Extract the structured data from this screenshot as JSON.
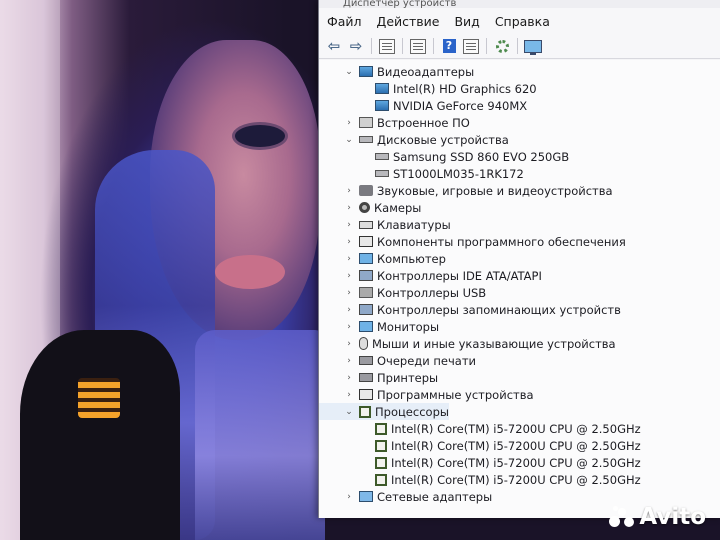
{
  "window": {
    "title": "Диспетчер устройств",
    "menu": [
      "Файл",
      "Действие",
      "Вид",
      "Справка"
    ]
  },
  "toolbar_icons": [
    "back-arrow-icon",
    "forward-arrow-icon",
    "properties-icon",
    "update-icon",
    "help-icon",
    "details-icon",
    "scan-icon",
    "monitor-icon"
  ],
  "tree": [
    {
      "label": "Видеоадаптеры",
      "level": 0,
      "expanded": true,
      "icon": "display-adapter-icon"
    },
    {
      "label": "Intel(R) HD Graphics 620",
      "level": 1,
      "icon": "display-adapter-icon"
    },
    {
      "label": "NVIDIA GeForce 940MX",
      "level": 1,
      "icon": "display-adapter-icon"
    },
    {
      "label": "Встроенное ПО",
      "level": 0,
      "expanded": false,
      "icon": "firmware-icon"
    },
    {
      "label": "Дисковые устройства",
      "level": 0,
      "expanded": true,
      "icon": "disk-icon"
    },
    {
      "label": "Samsung SSD 860 EVO 250GB",
      "level": 1,
      "icon": "disk-icon"
    },
    {
      "label": "ST1000LM035-1RK172",
      "level": 1,
      "icon": "disk-icon"
    },
    {
      "label": "Звуковые, игровые и видеоустройства",
      "level": 0,
      "expanded": false,
      "icon": "sound-icon"
    },
    {
      "label": "Камеры",
      "level": 0,
      "expanded": false,
      "icon": "camera-icon"
    },
    {
      "label": "Клавиатуры",
      "level": 0,
      "expanded": false,
      "icon": "keyboard-icon"
    },
    {
      "label": "Компоненты программного обеспечения",
      "level": 0,
      "expanded": false,
      "icon": "software-icon"
    },
    {
      "label": "Компьютер",
      "level": 0,
      "expanded": false,
      "icon": "computer-icon"
    },
    {
      "label": "Контроллеры IDE ATA/ATAPI",
      "level": 0,
      "expanded": false,
      "icon": "controller-icon"
    },
    {
      "label": "Контроллеры USB",
      "level": 0,
      "expanded": false,
      "icon": "usb-icon"
    },
    {
      "label": "Контроллеры запоминающих устройств",
      "level": 0,
      "expanded": false,
      "icon": "storage-controller-icon"
    },
    {
      "label": "Мониторы",
      "level": 0,
      "expanded": false,
      "icon": "monitor-icon"
    },
    {
      "label": "Мыши и иные указывающие устройства",
      "level": 0,
      "expanded": false,
      "icon": "mouse-icon"
    },
    {
      "label": "Очереди печати",
      "level": 0,
      "expanded": false,
      "icon": "print-queue-icon"
    },
    {
      "label": "Принтеры",
      "level": 0,
      "expanded": false,
      "icon": "printer-icon"
    },
    {
      "label": "Программные устройства",
      "level": 0,
      "expanded": false,
      "icon": "software-device-icon"
    },
    {
      "label": "Процессоры",
      "level": 0,
      "expanded": true,
      "icon": "cpu-icon"
    },
    {
      "label": "Intel(R) Core(TM) i5-7200U CPU @ 2.50GHz",
      "level": 1,
      "icon": "cpu-icon"
    },
    {
      "label": "Intel(R) Core(TM) i5-7200U CPU @ 2.50GHz",
      "level": 1,
      "icon": "cpu-icon"
    },
    {
      "label": "Intel(R) Core(TM) i5-7200U CPU @ 2.50GHz",
      "level": 1,
      "icon": "cpu-icon"
    },
    {
      "label": "Intel(R) Core(TM) i5-7200U CPU @ 2.50GHz",
      "level": 1,
      "icon": "cpu-icon"
    },
    {
      "label": "Сетевые адаптеры",
      "level": 0,
      "expanded": false,
      "icon": "network-adapter-icon"
    }
  ],
  "watermark": "Avito"
}
